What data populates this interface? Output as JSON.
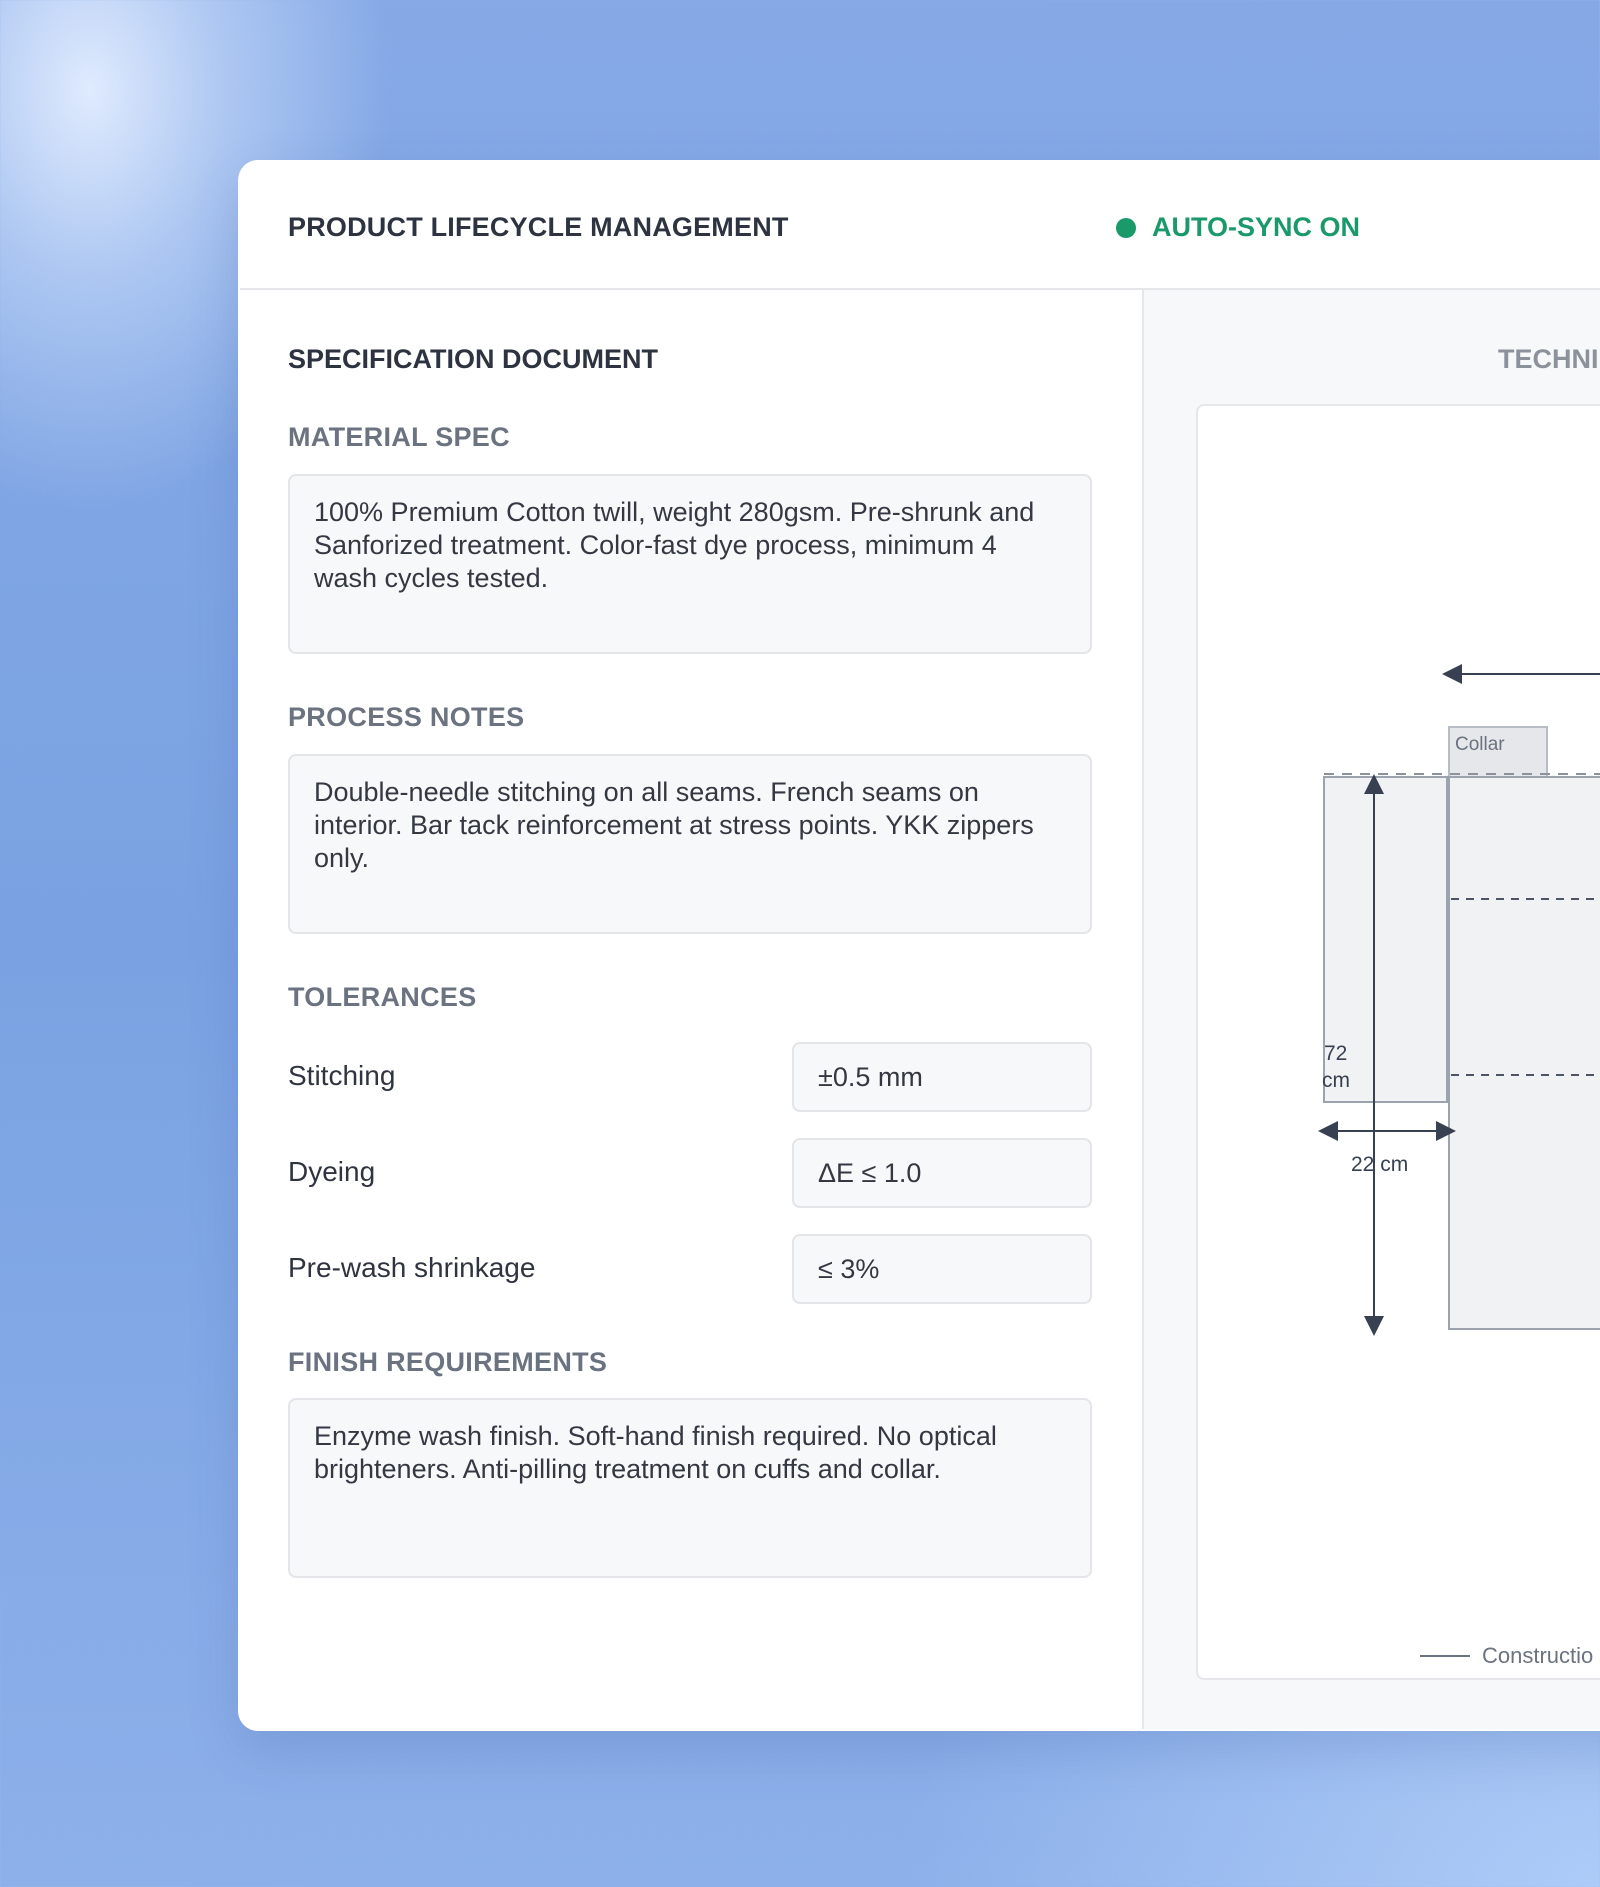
{
  "header": {
    "app_title": "PRODUCT LIFECYCLE MANAGEMENT",
    "sync_status": "AUTO-SYNC ON",
    "sync_color": "#1a9a6a"
  },
  "spec": {
    "section_title": "SPECIFICATION DOCUMENT",
    "material_label": "MATERIAL SPEC",
    "material_text": "100% Premium Cotton twill, weight 280gsm. Pre-shrunk and Sanforized treatment. Color-fast dye process, minimum 4 wash cycles tested.",
    "process_label": "PROCESS NOTES",
    "process_text": "Double-needle stitching on all seams. French seams on interior. Bar tack reinforcement at stress points. YKK zippers only.",
    "tolerances_label": "TOLERANCES",
    "tolerances": [
      {
        "label": "Stitching",
        "value": "±0.5 mm"
      },
      {
        "label": "Dyeing",
        "value": "ΔE ≤ 1.0"
      },
      {
        "label": "Pre-wash shrinkage",
        "value": "≤ 3%"
      }
    ],
    "finish_label": "FINISH REQUIREMENTS",
    "finish_text": "Enzyme wash finish. Soft-hand finish required. No optical brighteners. Anti-pilling treatment on cuffs and collar."
  },
  "drawing": {
    "title": "TECHNI",
    "collar_label": "Collar",
    "length_value": "72",
    "length_unit": "cm",
    "width_label": "22 cm",
    "legend_label": "Constructio"
  }
}
